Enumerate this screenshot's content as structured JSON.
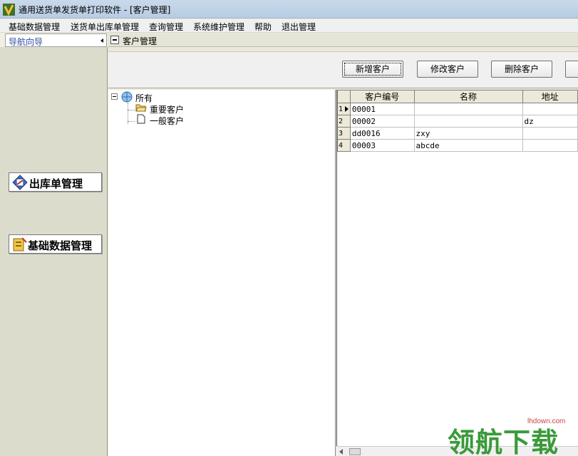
{
  "window": {
    "title": "通用送货单发货单打印软件  - [客户管理]"
  },
  "menu": [
    "基础数据管理",
    "送货单出库单管理",
    "查询管理",
    "系统维护管理",
    "帮助",
    "退出管理"
  ],
  "nav": {
    "header": "导航向导",
    "buttons": [
      {
        "label": "出库单管理",
        "icon": "outbound-icon"
      },
      {
        "label": "基础数据管理",
        "icon": "database-icon"
      }
    ]
  },
  "panel": {
    "title": "客户管理"
  },
  "toolbar": {
    "add": "新增客户",
    "edit": "修改客户",
    "delete": "删除客户"
  },
  "tree": {
    "root": "所有",
    "children": [
      "重要客户",
      "一般客户"
    ]
  },
  "grid": {
    "columns": [
      "客户编号",
      "名称",
      "地址"
    ],
    "rows": [
      {
        "idx": "1",
        "code": "00001",
        "name": "",
        "addr": ""
      },
      {
        "idx": "2",
        "code": "00002",
        "name": "",
        "addr": "dz"
      },
      {
        "idx": "3",
        "code": "dd0016",
        "name": "zxy",
        "addr": ""
      },
      {
        "idx": "4",
        "code": "00003",
        "name": "abcde",
        "addr": ""
      }
    ]
  },
  "watermark": {
    "text": "领航下载",
    "site": "lhdown.com"
  },
  "colors": {
    "watermark": "#3a9a3a",
    "nav_header_text": "#2b4fa0"
  }
}
